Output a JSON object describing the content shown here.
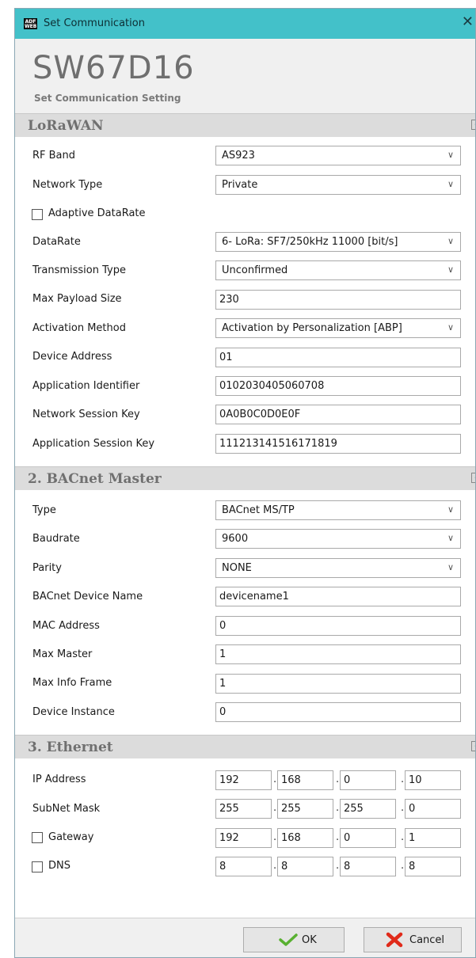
{
  "window": {
    "title": "Set Communication",
    "app_icon_text": "ADF WEB",
    "close_glyph": "✕"
  },
  "header": {
    "app_name": "SW67D16",
    "subtitle": "Set Communication Setting"
  },
  "sections": {
    "lorawan": {
      "title": "LoRaWAN",
      "rf_band": {
        "label": "RF Band",
        "value": "AS923"
      },
      "network_type": {
        "label": "Network Type",
        "value": "Private"
      },
      "adaptive_datarate": {
        "label": "Adaptive DataRate",
        "checked": false
      },
      "datarate": {
        "label": "DataRate",
        "value": "6- LoRa: SF7/250kHz 11000 [bit/s]"
      },
      "transmission_type": {
        "label": "Transmission Type",
        "value": "Unconfirmed"
      },
      "max_payload_size": {
        "label": "Max Payload Size",
        "value": "230"
      },
      "activation_method": {
        "label": "Activation Method",
        "value": "Activation by Personalization [ABP]"
      },
      "device_address": {
        "label": "Device Address",
        "value": "01"
      },
      "application_identifier": {
        "label": "Application Identifier",
        "value": "0102030405060708"
      },
      "network_session_key": {
        "label": "Network Session Key",
        "value": "0A0B0C0D0E0F"
      },
      "application_session_key": {
        "label": "Application Session Key",
        "value": "111213141516171819"
      }
    },
    "bacnet": {
      "title": "2. BACnet Master",
      "type": {
        "label": "Type",
        "value": "BACnet MS/TP"
      },
      "baudrate": {
        "label": "Baudrate",
        "value": "9600"
      },
      "parity": {
        "label": "Parity",
        "value": "NONE"
      },
      "device_name": {
        "label": "BACnet Device Name",
        "value": "devicename1"
      },
      "mac_address": {
        "label": "MAC Address",
        "value": "0"
      },
      "max_master": {
        "label": "Max Master",
        "value": "1"
      },
      "max_info_frame": {
        "label": "Max Info Frame",
        "value": "1"
      },
      "device_instance": {
        "label": "Device Instance",
        "value": "0"
      }
    },
    "ethernet": {
      "title": "3. Ethernet",
      "ip_address": {
        "label": "IP Address",
        "octets": [
          "192",
          "168",
          "0",
          "10"
        ]
      },
      "subnet_mask": {
        "label": "SubNet Mask",
        "octets": [
          "255",
          "255",
          "255",
          "0"
        ]
      },
      "gateway": {
        "label": "Gateway",
        "checked": false,
        "octets": [
          "192",
          "168",
          "0",
          "1"
        ]
      },
      "dns": {
        "label": "DNS",
        "checked": false,
        "octets": [
          "8",
          "8",
          "8",
          "8"
        ]
      }
    }
  },
  "footer": {
    "ok_label": "OK",
    "cancel_label": "Cancel"
  },
  "icons": {
    "dropdown": "chevron-down-icon",
    "collapse": "collapse-icon",
    "ok": "check-icon",
    "cancel": "x-icon"
  },
  "colors": {
    "titlebar": "#43c1c9",
    "section_header": "#dcdcdc",
    "ok_check": "#58b030",
    "cancel_x": "#e02a1a"
  }
}
